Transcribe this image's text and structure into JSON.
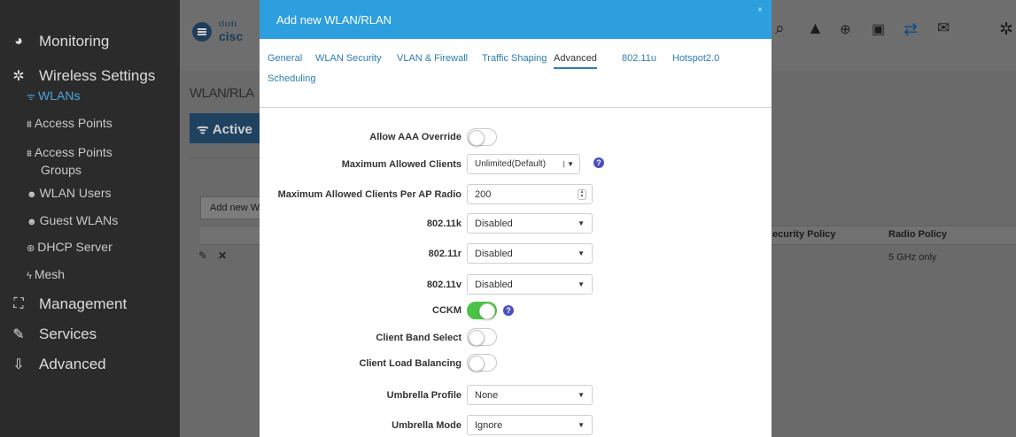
{
  "sidebar": {
    "main_items": [
      {
        "label": "Monitoring",
        "icon": "dashboard-icon"
      },
      {
        "label": "Wireless Settings",
        "icon": "gear-icon"
      },
      {
        "label": "Management",
        "icon": "sitemap-icon"
      },
      {
        "label": "Services",
        "icon": "wrench-icon"
      },
      {
        "label": "Advanced",
        "icon": "download-icon"
      }
    ],
    "sub_items": [
      {
        "label": "WLANs",
        "icon": "wifi-icon"
      },
      {
        "label": "Access Points",
        "icon": "access-point-icon"
      },
      {
        "label": "Access Points",
        "icon": "access-point-icon"
      },
      {
        "label": "Groups"
      },
      {
        "label": "WLAN Users",
        "icon": "users-icon"
      },
      {
        "label": "Guest WLANs",
        "icon": "users-icon"
      },
      {
        "label": "DHCP Server",
        "icon": "dhcp-icon"
      },
      {
        "label": "Mesh",
        "icon": "mesh-icon"
      }
    ]
  },
  "background": {
    "logo_text": "cisc",
    "breadcrumb": "WLAN/RLA",
    "active_tab": "Active",
    "add_new_button": "Add new WLA",
    "columns": [
      "ecurity Policy",
      "Radio Policy"
    ],
    "row_radio_policy": "5 GHz only",
    "toolbar_icons": [
      "search-icon",
      "alert-icon",
      "download-circle-icon",
      "save-icon",
      "transfer-icon",
      "mail-icon",
      "settings-icon"
    ]
  },
  "modal": {
    "title": "Add new WLAN/RLAN",
    "close": "×",
    "tabs": [
      "General",
      "WLAN Security",
      "VLAN & Firewall",
      "Traffic Shaping",
      "Advanced",
      "802.11u",
      "Hotspot2.0",
      "Scheduling"
    ],
    "active_tab": "Advanced",
    "fields": {
      "allow_aaa_override": {
        "label": "Allow AAA Override",
        "value": false
      },
      "max_clients": {
        "label": "Maximum Allowed Clients",
        "value": "Unlimited(Default)"
      },
      "max_clients_per_radio": {
        "label": "Maximum Allowed Clients Per AP Radio",
        "value": "200"
      },
      "dot11k": {
        "label": "802.11k",
        "value": "Disabled"
      },
      "dot11r": {
        "label": "802.11r",
        "value": "Disabled"
      },
      "dot11v": {
        "label": "802.11v",
        "value": "Disabled"
      },
      "cckm": {
        "label": "CCKM",
        "value": true
      },
      "client_band_select": {
        "label": "Client Band Select",
        "value": false
      },
      "client_load_balancing": {
        "label": "Client Load Balancing",
        "value": false
      },
      "umbrella_profile": {
        "label": "Umbrella Profile",
        "value": "None"
      },
      "umbrella_mode": {
        "label": "Umbrella Mode",
        "value": "Ignore"
      }
    }
  },
  "colors": {
    "modal_header": "#2d9fde",
    "toggle_on": "#4cc346",
    "link": "#2d7db3",
    "sidebar_active": "#4aa5dc"
  }
}
